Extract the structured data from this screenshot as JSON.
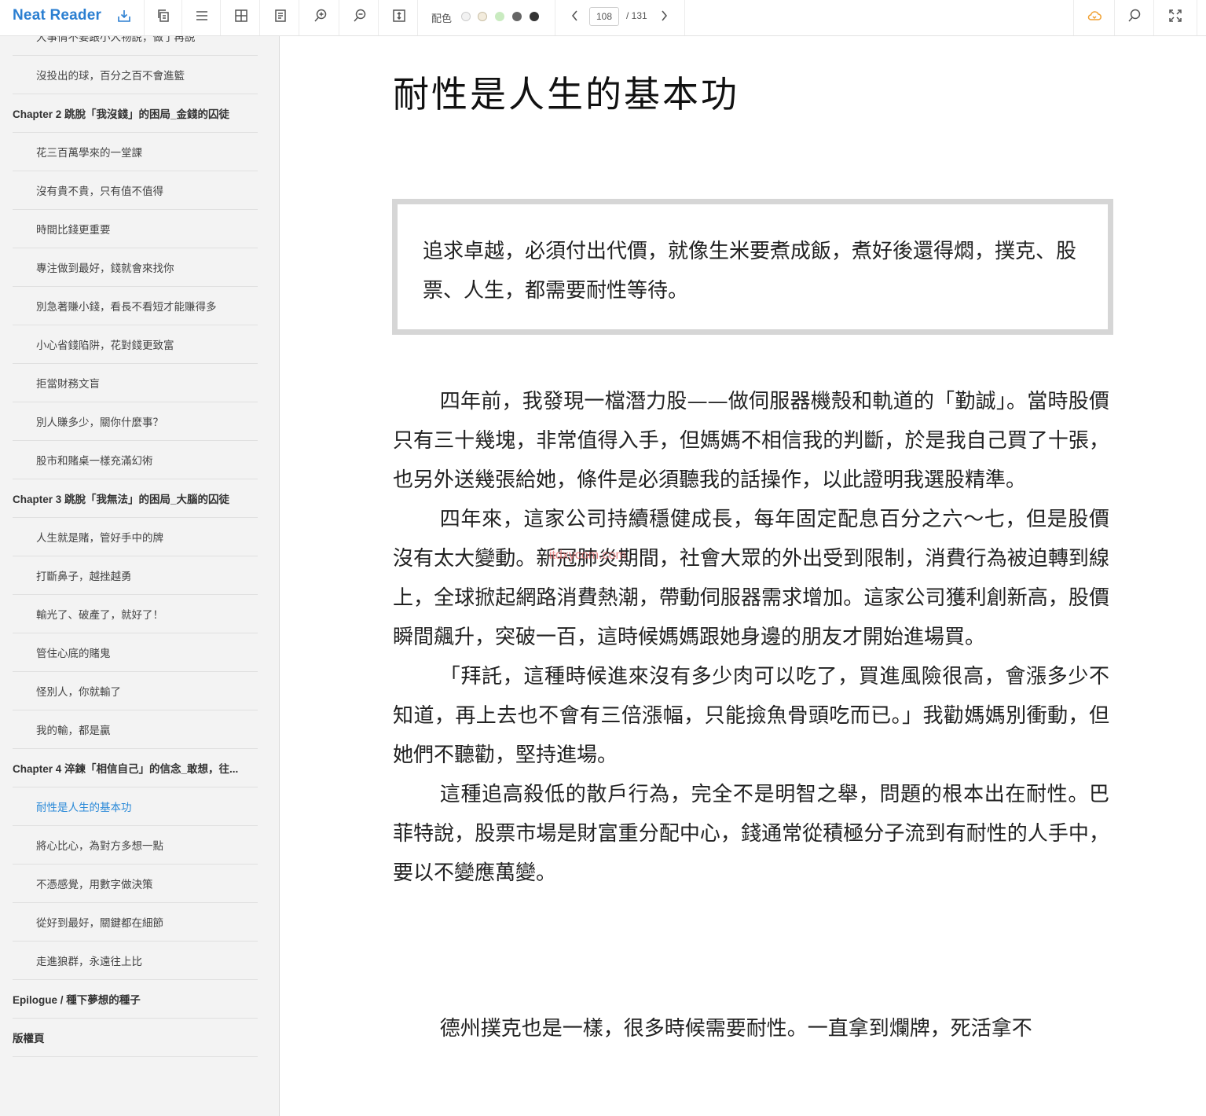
{
  "app": {
    "brand": "Neat Reader"
  },
  "toolbar": {
    "palette_label": "配色",
    "palette_colors": [
      "#f2f2f2",
      "#f3ecdd",
      "#c9ebc0",
      "#666666",
      "#333333"
    ],
    "current_page": "108",
    "total_pages": "/ 131"
  },
  "toc": [
    {
      "label": "大事情不要跟小人物說，做了再說",
      "level": 2
    },
    {
      "label": "沒投出的球，百分之百不會進籃",
      "level": 2
    },
    {
      "label": "Chapter 2 跳脫「我沒錢」的困局_金錢的囚徒",
      "level": 1
    },
    {
      "label": "花三百萬學來的一堂課",
      "level": 2
    },
    {
      "label": "沒有貴不貴，只有值不值得",
      "level": 2
    },
    {
      "label": "時間比錢更重要",
      "level": 2
    },
    {
      "label": "專注做到最好，錢就會來找你",
      "level": 2
    },
    {
      "label": "別急著賺小錢，看長不看短才能賺得多",
      "level": 2
    },
    {
      "label": "小心省錢陷阱，花對錢更致富",
      "level": 2
    },
    {
      "label": "拒當財務文盲",
      "level": 2
    },
    {
      "label": "別人賺多少，關你什麼事？",
      "level": 2
    },
    {
      "label": "股市和賭桌一樣充滿幻術",
      "level": 2
    },
    {
      "label": "Chapter 3 跳脫「我無法」的困局_大腦的囚徒",
      "level": 1
    },
    {
      "label": "人生就是賭，管好手中的牌",
      "level": 2
    },
    {
      "label": "打斷鼻子，越挫越勇",
      "level": 2
    },
    {
      "label": "輸光了、破產了，就好了！",
      "level": 2
    },
    {
      "label": "管住心底的賭鬼",
      "level": 2
    },
    {
      "label": "怪別人，你就輸了",
      "level": 2
    },
    {
      "label": "我的輸，都是贏",
      "level": 2
    },
    {
      "label": "Chapter 4 淬鍊「相信自己」的信念_敢想，往...",
      "level": 1
    },
    {
      "label": "耐性是人生的基本功",
      "level": 2,
      "active": true
    },
    {
      "label": "將心比心，為對方多想一點",
      "level": 2
    },
    {
      "label": "不憑感覺，用數字做決策",
      "level": 2
    },
    {
      "label": "從好到最好，關鍵都在細節",
      "level": 2
    },
    {
      "label": "走進狼群，永遠往上比",
      "level": 2
    },
    {
      "label": "Epilogue / 種下夢想的種子",
      "level": 1
    },
    {
      "label": "版權頁",
      "level": 1
    }
  ],
  "content": {
    "title": "耐性是人生的基本功",
    "quote": "追求卓越，必須付出代價，就像生米要煮成飯，煮好後還得燜，撲克、股票、人生，都需要耐性等待。",
    "paragraphs": [
      "四年前，我發現一檔潛力股——做伺服器機殼和軌道的「勤誠」。當時股價只有三十幾塊，非常值得入手，但媽媽不相信我的判斷，於是我自己買了十張，也另外送幾張給她，條件是必須聽我的話操作，以此證明我選股精準。",
      "四年來，這家公司持續穩健成長，每年固定配息百分之六～七，但是股價沒有太大變動。新冠肺炎期間，社會大眾的外出受到限制，消費行為被迫轉到線上，全球掀起網路消費熱潮，帶動伺服器需求增加。這家公司獲利創新高，股價瞬間飆升，突破一百，這時候媽媽跟她身邊的朋友才開始進場買。",
      "「拜託，這種時候進來沒有多少肉可以吃了，買進風險很高，會漲多少不知道，再上去也不會有三倍漲幅，只能撿魚骨頭吃而已。」我勸媽媽別衝動，但她們不聽勸，堅持進場。",
      "這種追高殺低的散戶行為，完全不是明智之舉，問題的根本出在耐性。巴菲特說，股票市場是財富重分配中心，錢通常從積極分子流到有耐性的人手中，要以不變應萬變。"
    ],
    "last_paragraph": "德州撲克也是一樣，很多時候需要耐性。一直拿到爛牌，死活拿不",
    "watermark": "itdxycom.com"
  }
}
